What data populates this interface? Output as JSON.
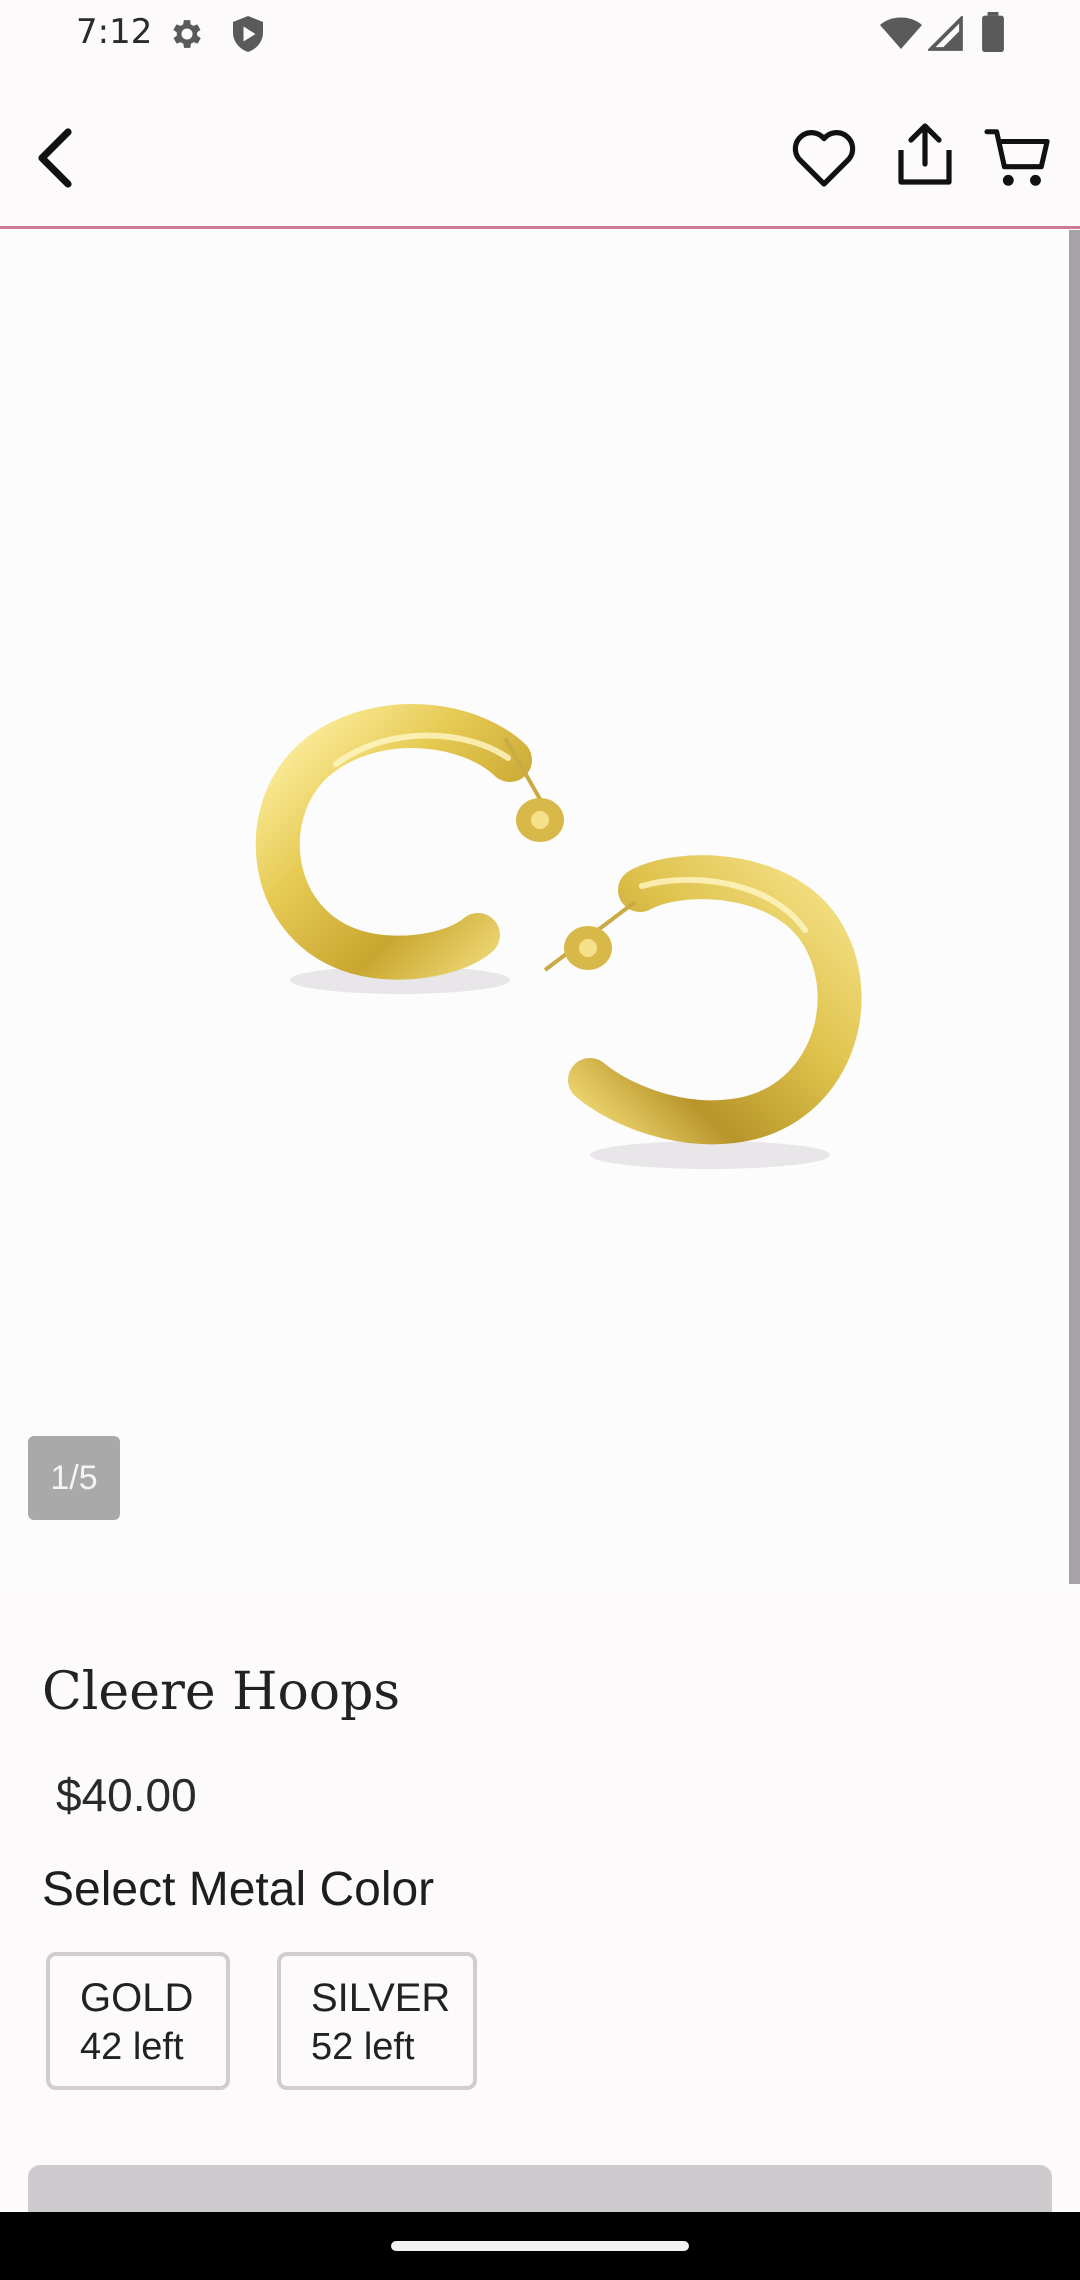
{
  "status_bar": {
    "time": "7:12",
    "icons": [
      "gear-icon",
      "shield-icon",
      "wifi-icon",
      "signal-icon",
      "battery-icon"
    ]
  },
  "app_bar": {
    "icons": [
      "back-arrow-icon",
      "heart-icon",
      "share-icon",
      "cart-icon"
    ],
    "divider_color": "#cf7a98"
  },
  "gallery": {
    "counter": "1/5",
    "image_subject": "gold hoop earrings"
  },
  "product": {
    "title": "Cleere Hoops",
    "price": "$40.00",
    "select_label": "Select Metal Color",
    "options": [
      {
        "name": "GOLD",
        "stock": "42 left"
      },
      {
        "name": "SILVER",
        "stock": "52 left"
      }
    ]
  },
  "colors": {
    "accent_pink": "#cf7a98",
    "gold": "#e6cb55",
    "button_disabled": "#cdcbce"
  }
}
